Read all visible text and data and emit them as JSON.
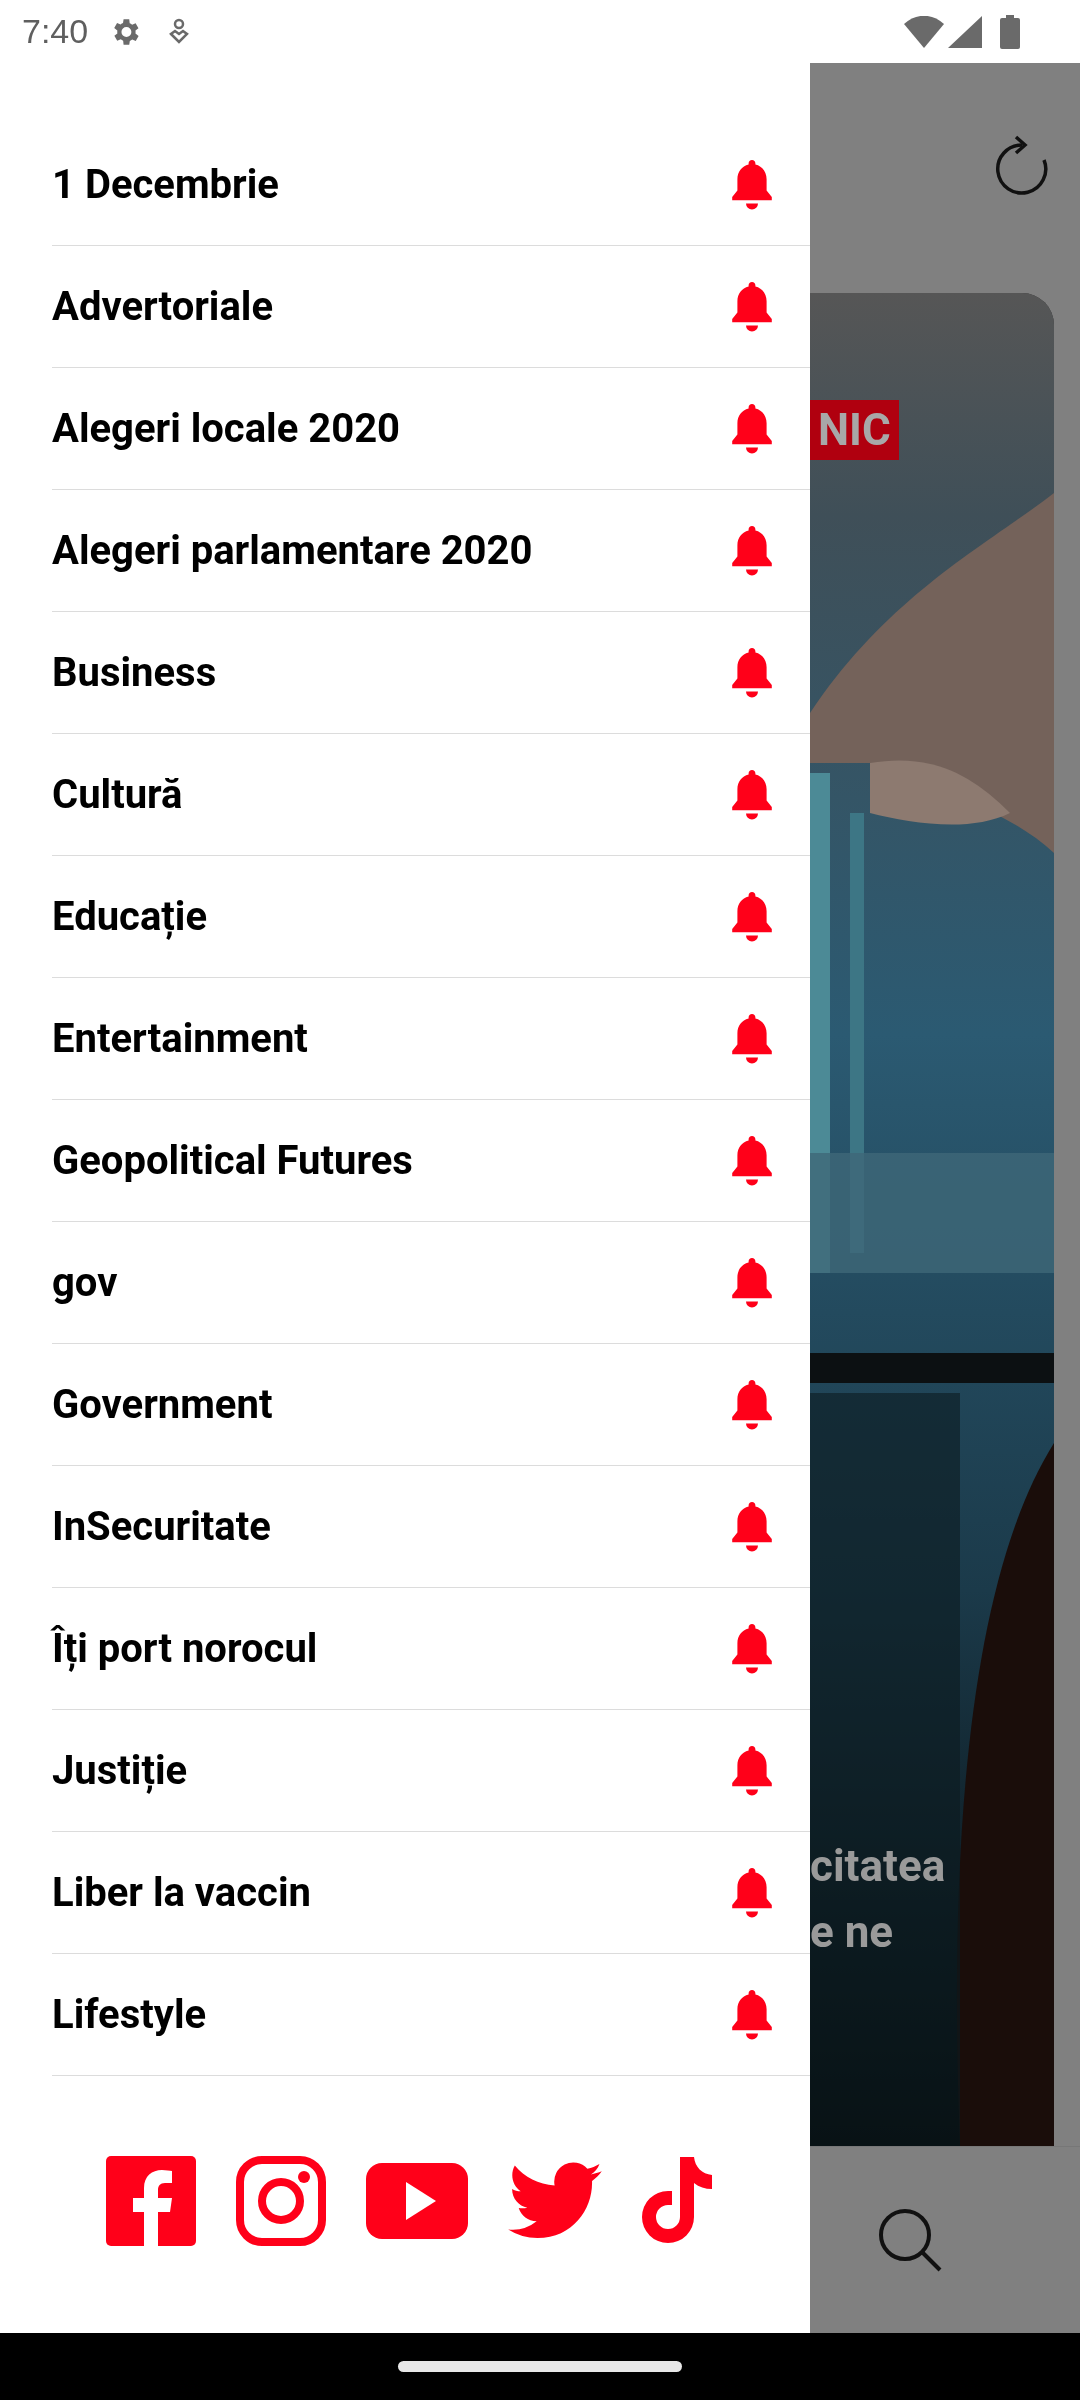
{
  "status_bar": {
    "time": "7:40"
  },
  "drawer": {
    "items": [
      {
        "label": "1 Decembrie"
      },
      {
        "label": "Advertoriale"
      },
      {
        "label": "Alegeri locale 2020"
      },
      {
        "label": "Alegeri parlamentare 2020"
      },
      {
        "label": "Business"
      },
      {
        "label": "Cultură"
      },
      {
        "label": "Educație"
      },
      {
        "label": "Entertainment"
      },
      {
        "label": "Geopolitical Futures"
      },
      {
        "label": "gov"
      },
      {
        "label": "Government"
      },
      {
        "label": "InSecuritate"
      },
      {
        "label": "Îți port norocul"
      },
      {
        "label": "Justiție"
      },
      {
        "label": "Liber la vaccin"
      },
      {
        "label": "Lifestyle"
      }
    ]
  },
  "article_card": {
    "badge": "NIC",
    "headline_lines": [
      "citatea",
      "e ne"
    ]
  }
}
